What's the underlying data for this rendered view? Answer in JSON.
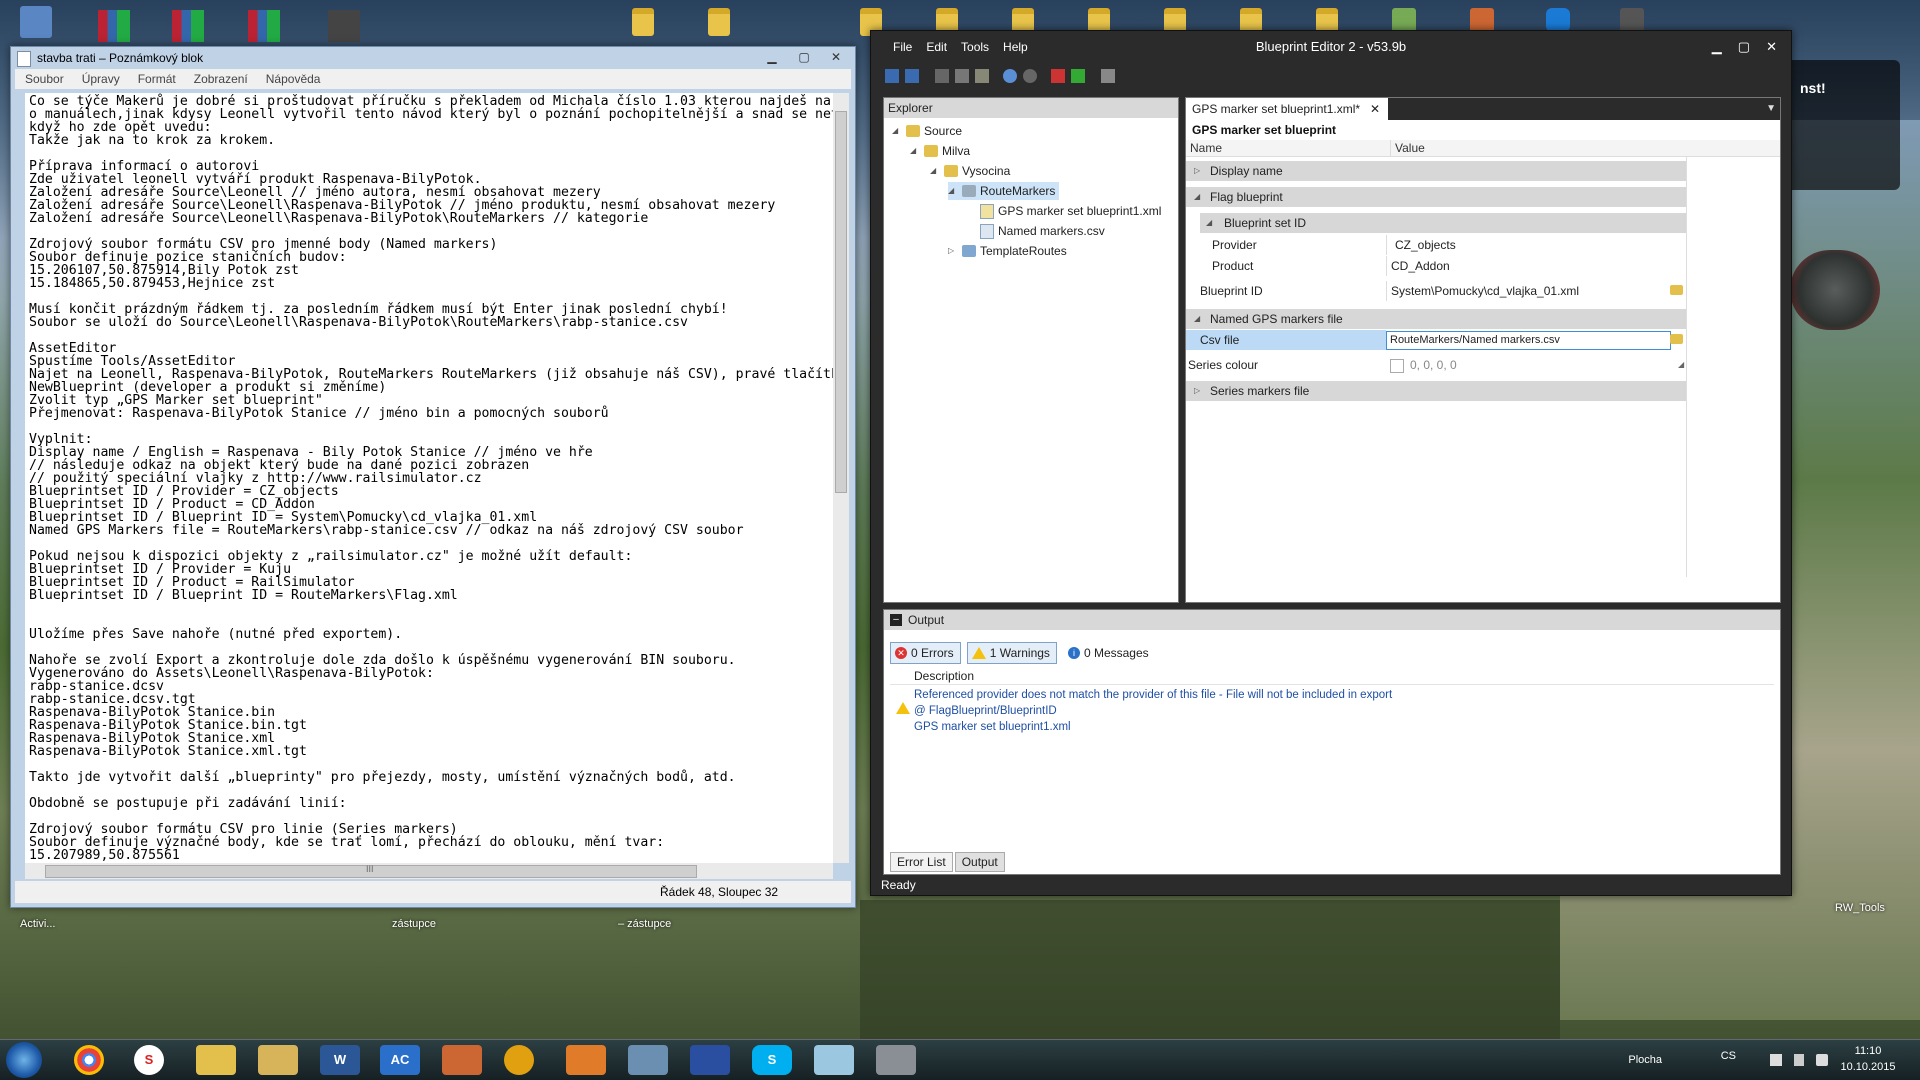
{
  "desktop": {
    "labels": [
      "Activi...",
      "zástupce",
      "– zástupce",
      "RW_Tools"
    ],
    "corner_text": "nst!"
  },
  "notepad": {
    "title": "stavba trati – Poznámkový blok",
    "menu": [
      "Soubor",
      "Úpravy",
      "Formát",
      "Zobrazení",
      "Nápověda"
    ],
    "text": "Co se týče Makerů je dobré si proštudovat příručku s překladem od Michala číslo 1.03 kterou najdeš na\no manuálech,jinak kdysy Leonell vytvořil tento návod který byl o poznání pochopitelnější a snad se net\nkdyž ho zde opět uvedu:\nTakže jak na to krok za krokem.\n\nPříprava informací o autorovi\nZde uživatel leonell vytváří produkt Raspenava-BilyPotok.\nZaložení adresáře Source\\Leonell // jméno autora, nesmí obsahovat mezery\nZaložení adresáře Source\\Leonell\\Raspenava-BilyPotok // jméno produktu, nesmí obsahovat mezery\nZaložení adresáře Source\\Leonell\\Raspenava-BilyPotok\\RouteMarkers // kategorie\n\nZdrojový soubor formátu CSV pro jmenné body (Named markers)\nSoubor definuje pozice staničních budov:\n15.206107,50.875914,Bily Potok zst\n15.184865,50.879453,Hejnice zst\n\nMusí končit prázdným řádkem tj. za posledním řádkem musí být Enter jinak poslední chybí!\nSoubor se uloží do Source\\Leonell\\Raspenava-BilyPotok\\RouteMarkers\\rabp-stanice.csv\n\nAssetEditor\nSpustíme Tools/AssetEditor\nNajet na Leonell, Raspenava-BilyPotok, RouteMarkers RouteMarkers (již obsahuje náš CSV), pravé tlačítk\nNewBlueprint (developer a produkt si změníme)\nZvolit typ „GPS Marker set blueprint\"\nPřejmenovat: Raspenava-BilyPotok Stanice // jméno bin a pomocných souborů\n\nVyplnit:\nDisplay name / English = Raspenava - Bily Potok Stanice // jméno ve hře\n// následuje odkaz na objekt který bude na dané pozici zobrazen\n// použitý speciální vlajky z http://www.railsimulator.cz\nBlueprintset ID / Provider = CZ_objects\nBlueprintset ID / Product = CD_Addon\nBlueprintset ID / Blueprint ID = System\\Pomucky\\cd_vlajka_01.xml\nNamed GPS Markers file = RouteMarkers\\rabp-stanice.csv // odkaz na náš zdrojový CSV soubor\n\nPokud nejsou k dispozici objekty z „railsimulator.cz\" je možné užít default:\nBlueprintset ID / Provider = Kuju\nBlueprintset ID / Product = RailSimulator\nBlueprintset ID / Blueprint ID = RouteMarkers\\Flag.xml\n\n\nUložíme přes Save nahoře (nutné před exportem).\n\nNahoře se zvolí Export a zkontroluje dole zda došlo k úspěšnému vygenerování BIN souboru.\nVygenerováno do Assets\\Leonell\\Raspenava-BilyPotok:\nrabp-stanice.dcsv\nrabp-stanice.dcsv.tgt\nRaspenava-BilyPotok Stanice.bin\nRaspenava-BilyPotok Stanice.bin.tgt\nRaspenava-BilyPotok Stanice.xml\nRaspenava-BilyPotok Stanice.xml.tgt\n\nTakto jde vytvořit další „blueprinty\" pro přejezdy, mosty, umístění význačných bodů, atd.\n\nObdobně se postupuje při zadávání linií:\n\nZdrojový soubor formátu CSV pro linie (Series markers)\nSoubor definuje význačné body, kde se trať lomí, přechází do oblouku, mění tvar:\n15.207989,50.875561",
    "hscroll_label": "III",
    "status": "Řádek 48, Sloupec 32"
  },
  "blueprint_editor": {
    "title": "Blueprint Editor 2 - v53.9b",
    "menu": [
      "File",
      "Edit",
      "Tools",
      "Help"
    ],
    "explorer": {
      "title": "Explorer",
      "tree": [
        {
          "label": "Source",
          "level": 0,
          "expanded": true,
          "type": "folder"
        },
        {
          "label": "Milva",
          "level": 1,
          "expanded": true,
          "type": "folder"
        },
        {
          "label": "Vysocina",
          "level": 2,
          "expanded": true,
          "type": "folder"
        },
        {
          "label": "RouteMarkers",
          "level": 3,
          "expanded": true,
          "type": "folder",
          "selected": true
        },
        {
          "label": "GPS marker set blueprint1.xml",
          "level": 4,
          "type": "file"
        },
        {
          "label": "Named markers.csv",
          "level": 4,
          "type": "file"
        },
        {
          "label": "TemplateRoutes",
          "level": 3,
          "expanded": false,
          "type": "folder"
        }
      ]
    },
    "doc_tab": {
      "label": "GPS marker set blueprint1.xml*",
      "close": "✕"
    },
    "blueprint_heading": "GPS marker set blueprint",
    "grid_headers": {
      "name": "Name",
      "value": "Value"
    },
    "props": {
      "display_name": "Display name",
      "flag_blueprint": "Flag blueprint",
      "blueprint_set_id": "Blueprint set ID",
      "provider_label": "Provider",
      "provider_value": "CZ_objects",
      "product_label": "Product",
      "product_value": "CD_Addon",
      "blueprint_id_label": "Blueprint ID",
      "blueprint_id_value": "System\\Pomucky\\cd_vlajka_01.xml",
      "named_gps_markers_file": "Named GPS markers file",
      "csv_file_label": "Csv file",
      "csv_file_value": "RouteMarkers/Named markers.csv",
      "series_colour_label": "Series colour",
      "series_colour_value": "0, 0, 0, 0",
      "series_markers_file": "Series markers file"
    },
    "output": {
      "title": "Output",
      "errors": "0 Errors",
      "warnings": "1 Warnings",
      "messages": "0 Messages",
      "desc_header": "Description",
      "message_lines": [
        "Referenced provider does not match the provider of this file - File will not be included in export",
        "@ FlagBlueprint/BlueprintID",
        "GPS marker set blueprint1.xml"
      ],
      "tabs": [
        "Error List",
        "Output"
      ]
    },
    "status": "Ready"
  },
  "taskbar": {
    "icons": [
      "chrome-icon",
      "s-icon",
      "folder-icon",
      "explorer-icon",
      "word-icon",
      "ac-icon",
      "rw-icon",
      "cs-icon",
      "media-icon",
      "tool-icon",
      "save-icon",
      "skype-icon",
      "notepad-icon",
      "settings-icon"
    ],
    "ac_text": "AC",
    "s_text": "S",
    "tray": {
      "plocha": "Plocha",
      "lang": "CS",
      "time": "11:10",
      "date": "10.10.2015"
    }
  }
}
